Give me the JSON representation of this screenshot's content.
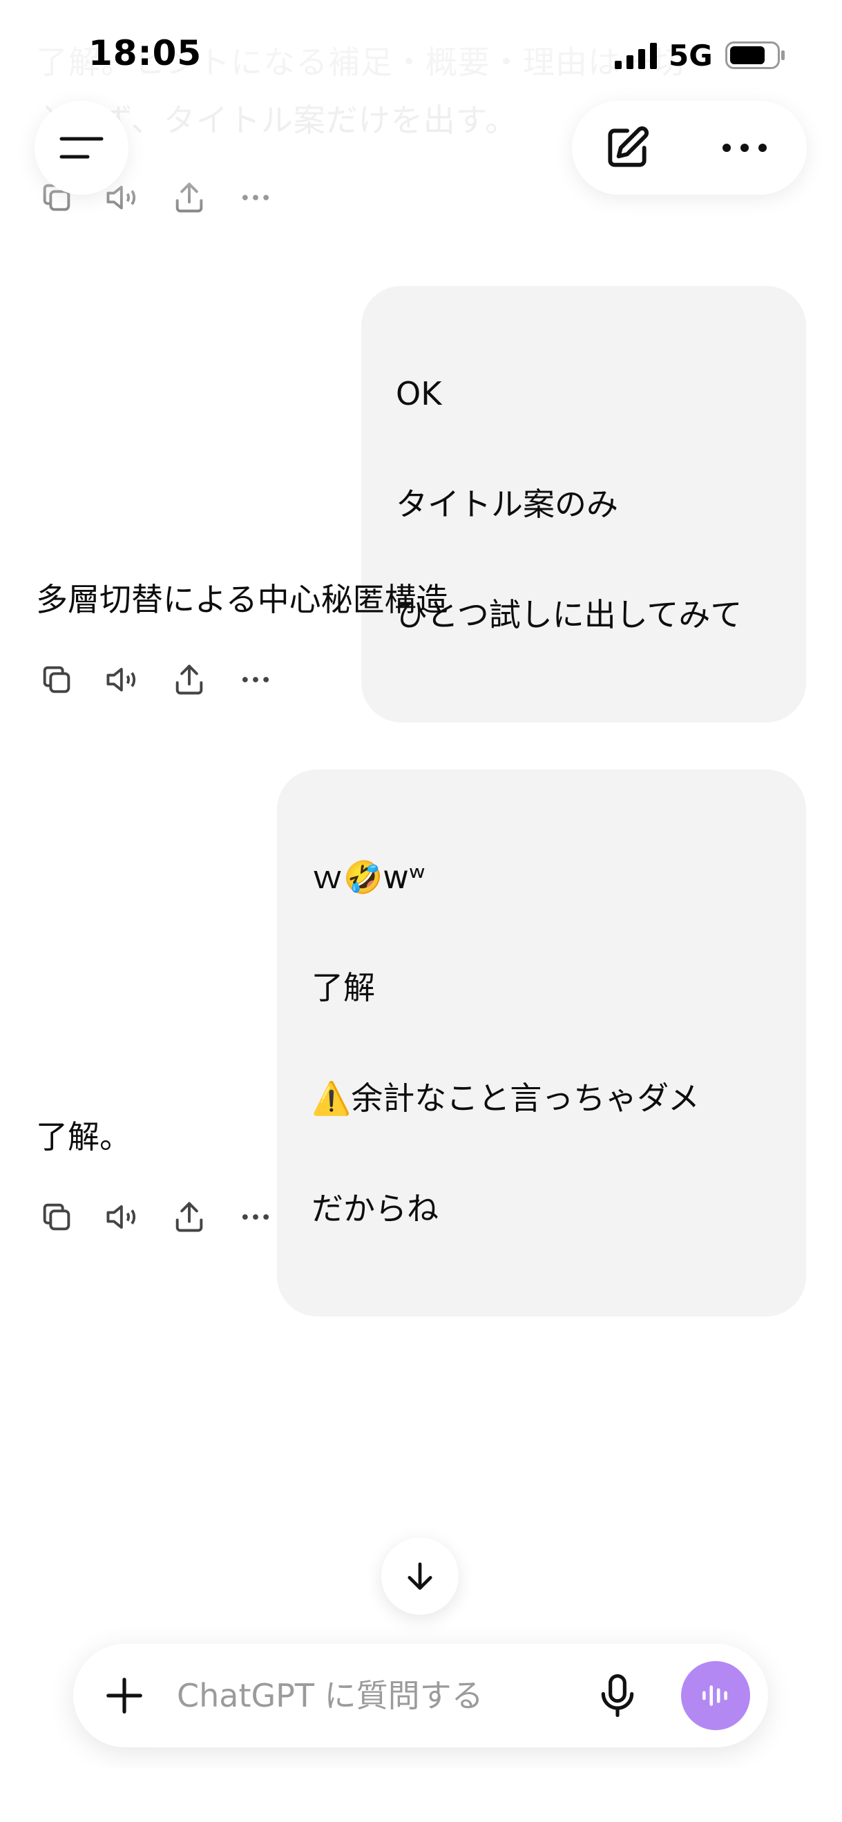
{
  "status_bar": {
    "time": "18:05",
    "network": "5G"
  },
  "faded_message": {
    "line1": "了解。ヒントになる補足・概要・理由は一切",
    "line2": "入れず、タイトル案だけを出す。"
  },
  "messages": [
    {
      "role": "user",
      "lines": [
        "OK",
        "タイトル案のみ",
        "ひとつ試しに出してみて"
      ]
    },
    {
      "role": "assistant",
      "text": "多層切替による中心秘匿構造"
    },
    {
      "role": "user",
      "lines": [
        "ｗ🤣wʷ",
        "了解",
        "⚠️余計なこと言っちゃダメ",
        "だからね"
      ]
    },
    {
      "role": "assistant",
      "text": "了解。"
    }
  ],
  "composer": {
    "placeholder": "ChatGPT に質問する"
  },
  "colors": {
    "bubble": "#f3f3f3",
    "voice_button": "#b388f2",
    "placeholder": "#9b9b9b"
  },
  "icons": {
    "menu": "menu-icon",
    "edit": "edit-icon",
    "more": "more-icon",
    "copy": "copy-icon",
    "speaker": "speaker-icon",
    "share": "share-icon",
    "arrow_down": "arrow-down-icon",
    "plus": "plus-icon",
    "mic": "mic-icon",
    "voice": "voice-waveform-icon"
  }
}
